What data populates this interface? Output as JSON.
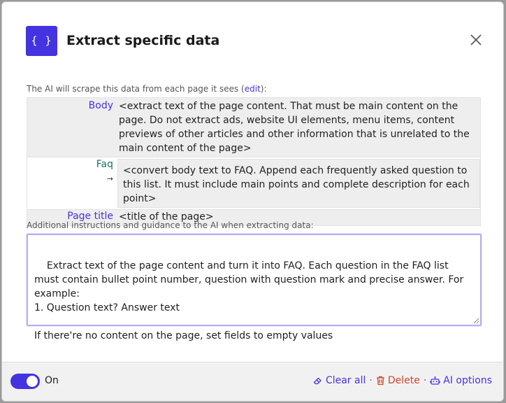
{
  "header": {
    "logo_text": "{ }",
    "title": "Extract specific data"
  },
  "scrape_caption": {
    "prefix": "The AI will scrape this data from each page it sees (",
    "link": "edit",
    "suffix": "):"
  },
  "fields": {
    "body": {
      "name": "Body",
      "value": "<extract text of the page content. That must be main content on the page. Do not extract ads, website UI elements, menu items, content previews of other articles and other information that is unrelated to the main content of the page>"
    },
    "faq": {
      "name": "Faq",
      "arrow": "→",
      "value": "<convert body text to FAQ. Append each frequently asked question to this list. It must include main points and complete description for each point>"
    },
    "page_title": {
      "name": "Page title",
      "value": "<title of the page>"
    }
  },
  "instructions": {
    "label": "Additional instructions and guidance to the AI when extracting data:",
    "value": "Extract text of the page content and turn it into FAQ. Each question in the FAQ list must contain bullet point number, question with question mark and precise answer. For example:\n1. Question text? Answer text\n\nIf there're no content on the page, set fields to empty values"
  },
  "footer": {
    "toggle_label": "On",
    "toggle_on": true,
    "clear_all": "Clear all",
    "separator": "·",
    "delete": "Delete",
    "ai_options": "AI options"
  },
  "colors": {
    "accent": "#4433e0",
    "danger": "#d2442e"
  }
}
